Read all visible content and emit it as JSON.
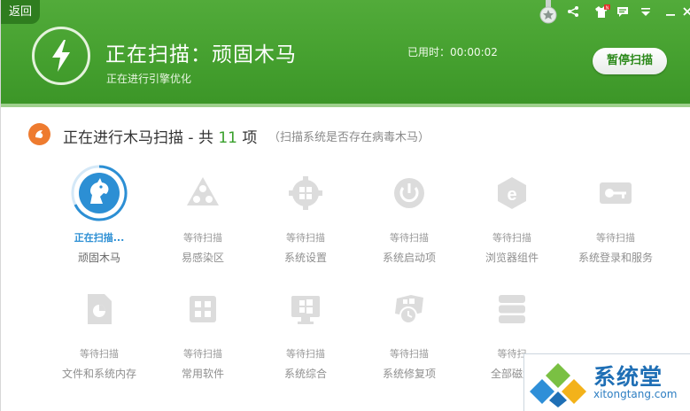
{
  "header": {
    "back_label": "返回",
    "title": "正在扫描：顽固木马",
    "subtitle": "正在进行引擎优化",
    "elapsed": "已用时：00:00:02",
    "pause_label": "暂停扫描"
  },
  "section": {
    "title_prefix": "正在进行木马扫描 - 共",
    "count": "11",
    "title_suffix": "项",
    "hint": "（扫描系统是否存在病毒木马）"
  },
  "items": [
    {
      "status": "正在扫描...",
      "name": "顽固木马",
      "icon": "trojan-horse-icon"
    },
    {
      "status": "等待扫描",
      "name": "易感染区",
      "icon": "biohazard-icon"
    },
    {
      "status": "等待扫描",
      "name": "系统设置",
      "icon": "windows-gear-icon"
    },
    {
      "status": "等待扫描",
      "name": "系统启动项",
      "icon": "power-icon"
    },
    {
      "status": "等待扫描",
      "name": "浏览器组件",
      "icon": "browser-icon"
    },
    {
      "status": "等待扫描",
      "name": "系统登录和服务",
      "icon": "key-icon"
    },
    {
      "status": "等待扫描",
      "name": "文件和系统内存",
      "icon": "file-icon"
    },
    {
      "status": "等待扫描",
      "name": "常用软件",
      "icon": "software-icon"
    },
    {
      "status": "等待扫描",
      "name": "系统综合",
      "icon": "windows-monitor-icon"
    },
    {
      "status": "等待扫描",
      "name": "系统修复项",
      "icon": "repair-icon"
    },
    {
      "status": "等待扫",
      "name": "全部磁盘",
      "icon": "disk-icon"
    }
  ],
  "watermark": {
    "text": "系统堂",
    "url": "xitongtang.com"
  },
  "colors": {
    "header_green": "#45a02f",
    "active_blue": "#2c8fd4",
    "count_green": "#3aa02c",
    "section_orange": "#ee7b2f"
  }
}
